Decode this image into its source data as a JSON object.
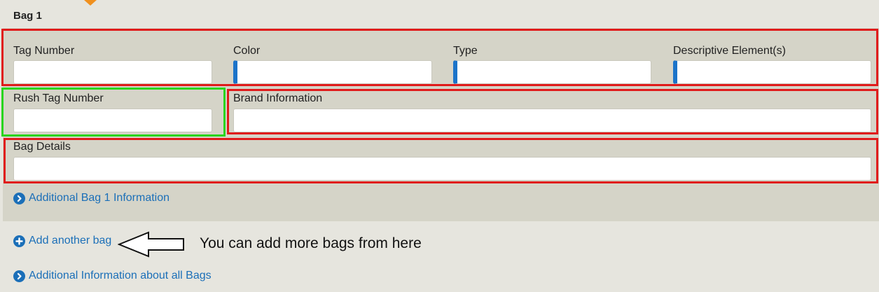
{
  "bag": {
    "title": "Bag 1",
    "fields": {
      "tag_number": {
        "label": "Tag Number",
        "value": ""
      },
      "color": {
        "label": "Color",
        "value": ""
      },
      "type": {
        "label": "Type",
        "value": ""
      },
      "descriptive_elements": {
        "label": "Descriptive Element(s)",
        "value": ""
      },
      "rush_tag_number": {
        "label": "Rush Tag Number",
        "value": ""
      },
      "brand_information": {
        "label": "Brand Information",
        "value": ""
      },
      "bag_details": {
        "label": "Bag Details",
        "value": ""
      }
    },
    "additional_info_link": "Additional Bag 1 Information"
  },
  "actions": {
    "add_bag_link": "Add another bag",
    "all_bags_info_link": "Additional Information about all Bags"
  },
  "annotation": {
    "text": "You can add more bags from here"
  },
  "colors": {
    "link": "#1b6fb8",
    "highlight_red": "#e01b1b",
    "highlight_green": "#29d41e",
    "select_accent": "#1b73c9",
    "panel": "#d5d4c8",
    "page": "#e6e5de",
    "step_marker": "#f0901e"
  },
  "icons": {
    "bag_info": "chevron-right-circle-icon",
    "add_bag": "plus-circle-icon",
    "all_bags_info": "chevron-right-circle-icon",
    "annotation": "left-arrow-icon"
  }
}
